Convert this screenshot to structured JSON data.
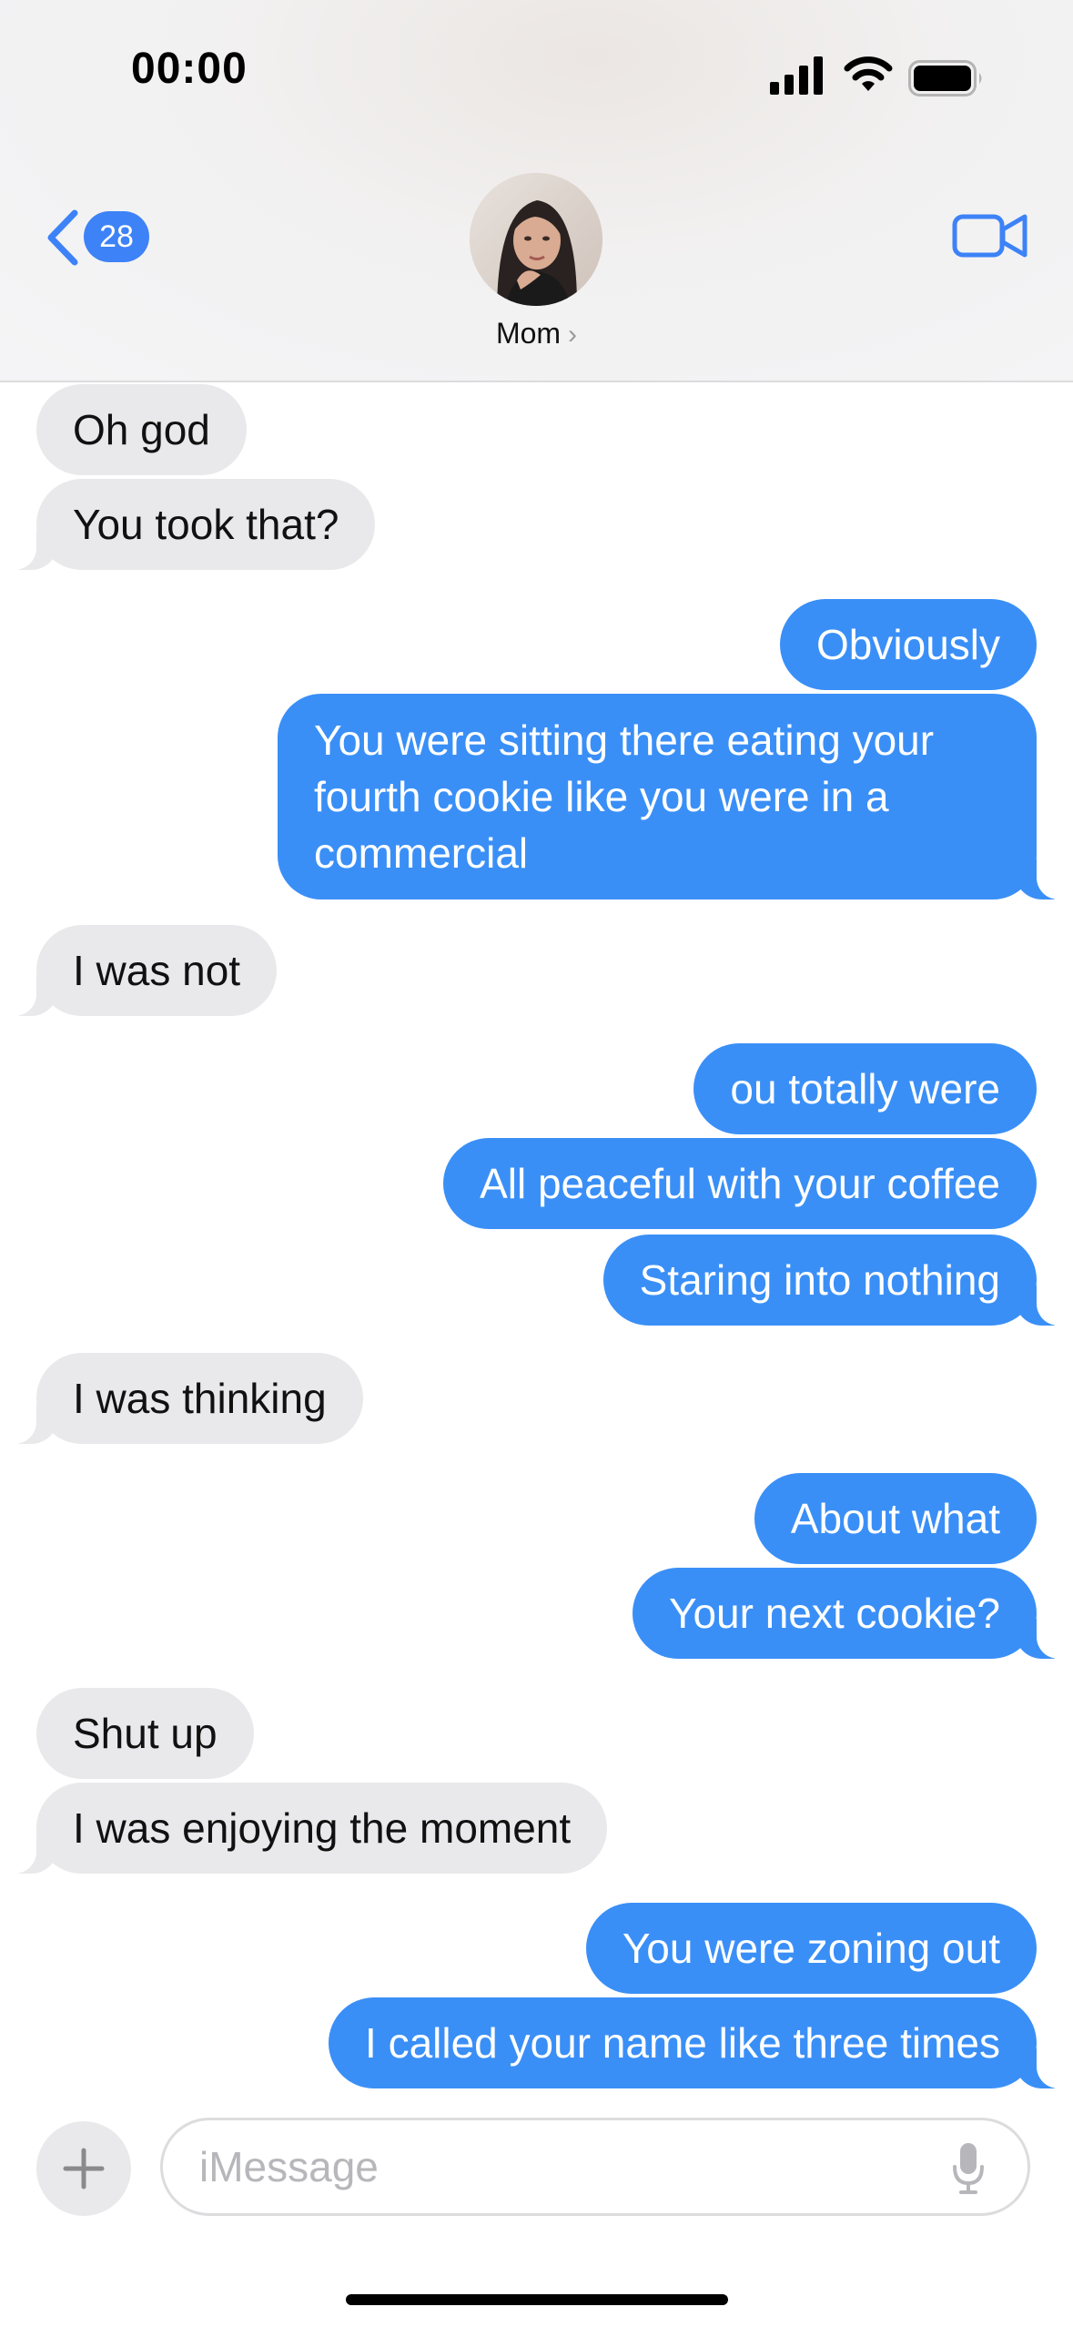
{
  "status_bar": {
    "time": "00:00"
  },
  "header": {
    "back_badge_count": "28",
    "contact_name": "Mom",
    "contact_chevron": "›",
    "accent_color": "#3d82f7"
  },
  "messages": [
    {
      "side": "received",
      "text": "Oh god"
    },
    {
      "side": "received",
      "text": "You took that?"
    },
    {
      "side": "sent",
      "text": "Obviously"
    },
    {
      "side": "sent",
      "text": "You were sitting there eating your fourth cookie like you were in a commercial"
    },
    {
      "side": "received",
      "text": "I was not"
    },
    {
      "side": "sent",
      "text": "ou totally were"
    },
    {
      "side": "sent",
      "text": "All peaceful with your coffee"
    },
    {
      "side": "sent",
      "text": "Staring into nothing"
    },
    {
      "side": "received",
      "text": "I was thinking"
    },
    {
      "side": "sent",
      "text": "About what"
    },
    {
      "side": "sent",
      "text": "Your next cookie?"
    },
    {
      "side": "received",
      "text": "Shut up"
    },
    {
      "side": "received",
      "text": "I was enjoying the moment"
    },
    {
      "side": "sent",
      "text": "You were zoning out"
    },
    {
      "side": "sent",
      "text": "I called your name like three times"
    }
  ],
  "composer": {
    "placeholder": "iMessage",
    "value": ""
  },
  "colors": {
    "sent_bubble": "#3a8ff7",
    "received_bubble": "#e9e9eb"
  },
  "icons": {
    "back": "chevron-left-icon",
    "video": "video-camera-icon",
    "plus": "plus-icon",
    "mic": "microphone-icon"
  }
}
